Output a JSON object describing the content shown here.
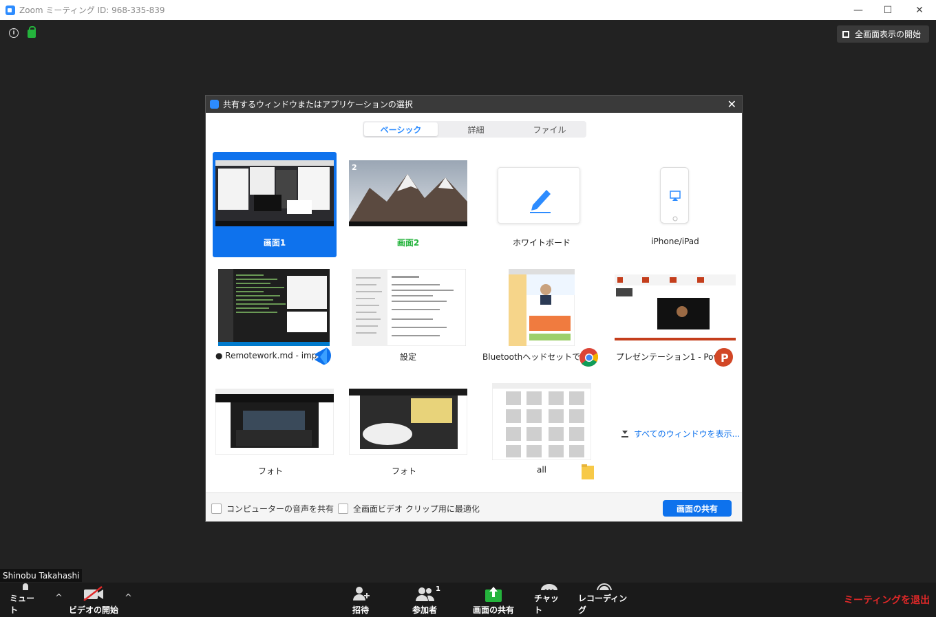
{
  "window": {
    "title": "Zoom ミーティング ID: 968-335-839",
    "minimize": "—",
    "maximize": "☐",
    "close": "✕"
  },
  "top": {
    "fullscreen_label": "全画面表示の開始",
    "info": "i"
  },
  "dialog": {
    "title": "共有するウィンドウまたはアプリケーションの選択",
    "close": "✕",
    "tabs": [
      "ベーシック",
      "詳細",
      "ファイル"
    ],
    "tiles": [
      {
        "label": "画面1",
        "selected": true
      },
      {
        "label": "画面2",
        "number": "2"
      },
      {
        "label": "ホワイトボード"
      },
      {
        "label": "iPhone/iPad"
      },
      {
        "label": "● Remotework.md - imp..."
      },
      {
        "label": "設定"
      },
      {
        "label": "Bluetoothヘッドセットで..."
      },
      {
        "label": "プレゼンテーション1 - Pow..."
      },
      {
        "label": "フォト"
      },
      {
        "label": "フォト"
      },
      {
        "label": "all"
      }
    ],
    "show_all": "すべてのウィンドウを表示...",
    "share_audio": "コンピューターの音声を共有",
    "optimize_video": "全画面ビデオ クリップ用に最適化",
    "share_button": "画面の共有"
  },
  "participant_name": "Shinobu Takahashi",
  "toolbar": {
    "mute": "ミュート",
    "video": "ビデオの開始",
    "invite": "招待",
    "participants": "参加者",
    "participants_count": "1",
    "share": "画面の共有",
    "chat": "チャット",
    "record": "レコーディング",
    "leave": "ミーティングを退出",
    "caret": "^"
  },
  "colors": {
    "accent": "#0e72ed",
    "green": "#24b33c",
    "leave": "#e02828"
  }
}
